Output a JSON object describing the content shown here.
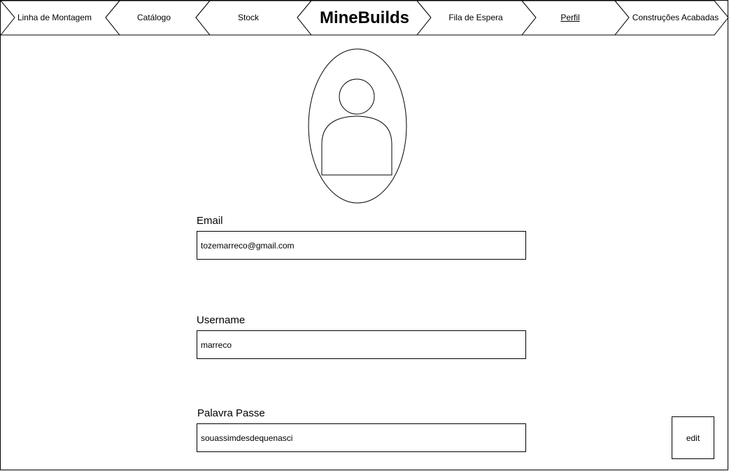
{
  "nav": {
    "items": [
      {
        "label": "Linha de Montagem"
      },
      {
        "label": "Catálogo"
      },
      {
        "label": "Stock"
      },
      {
        "label": "Fila de Espera"
      },
      {
        "label": "Perfil"
      },
      {
        "label": "Construções Acabadas"
      }
    ],
    "brand": "MineBuilds"
  },
  "profile": {
    "email": {
      "label": "Email",
      "value": "tozemarreco@gmail.com"
    },
    "username": {
      "label": "Username",
      "value": "marreco"
    },
    "password": {
      "label": "Palavra Passe",
      "value": "souassimdesdequenasci"
    },
    "edit_label": "edit"
  }
}
